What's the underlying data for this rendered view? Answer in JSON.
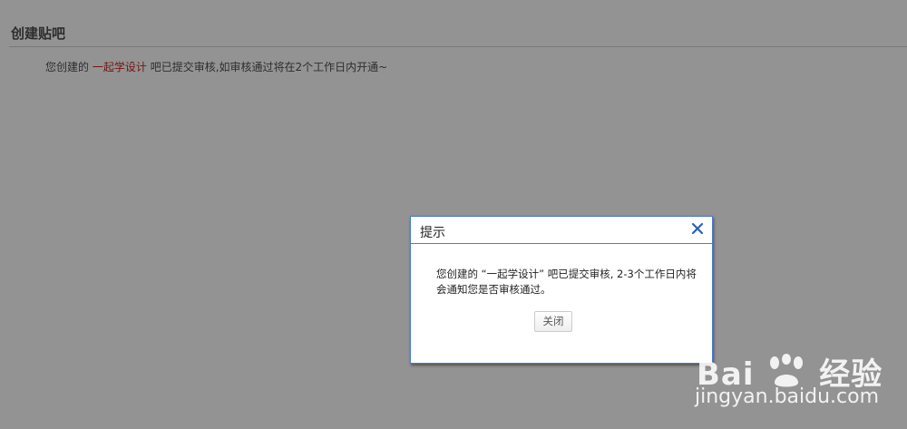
{
  "page": {
    "title": "创建贴吧",
    "message_prefix": "您创建的",
    "message_highlight": "一起学设计",
    "message_suffix": "吧已提交审核,如审核通过将在2个工作日内开通~"
  },
  "dialog": {
    "title": "提示",
    "body": "您创建的 “一起学设计” 吧已提交审核, 2-3个工作日内将会通知您是否审核通过。",
    "close_button": "关闭"
  },
  "watermark": {
    "brand_a": "Bai",
    "brand_b": "经验",
    "url": "jingyan.baidu.com"
  },
  "colors": {
    "accent": "#4a7cc9",
    "highlight": "#c00000",
    "overlay": "rgba(40,40,40,0.5)"
  },
  "icons": {
    "close": "close-icon",
    "watermark_paw": "baidu-paw-icon"
  }
}
